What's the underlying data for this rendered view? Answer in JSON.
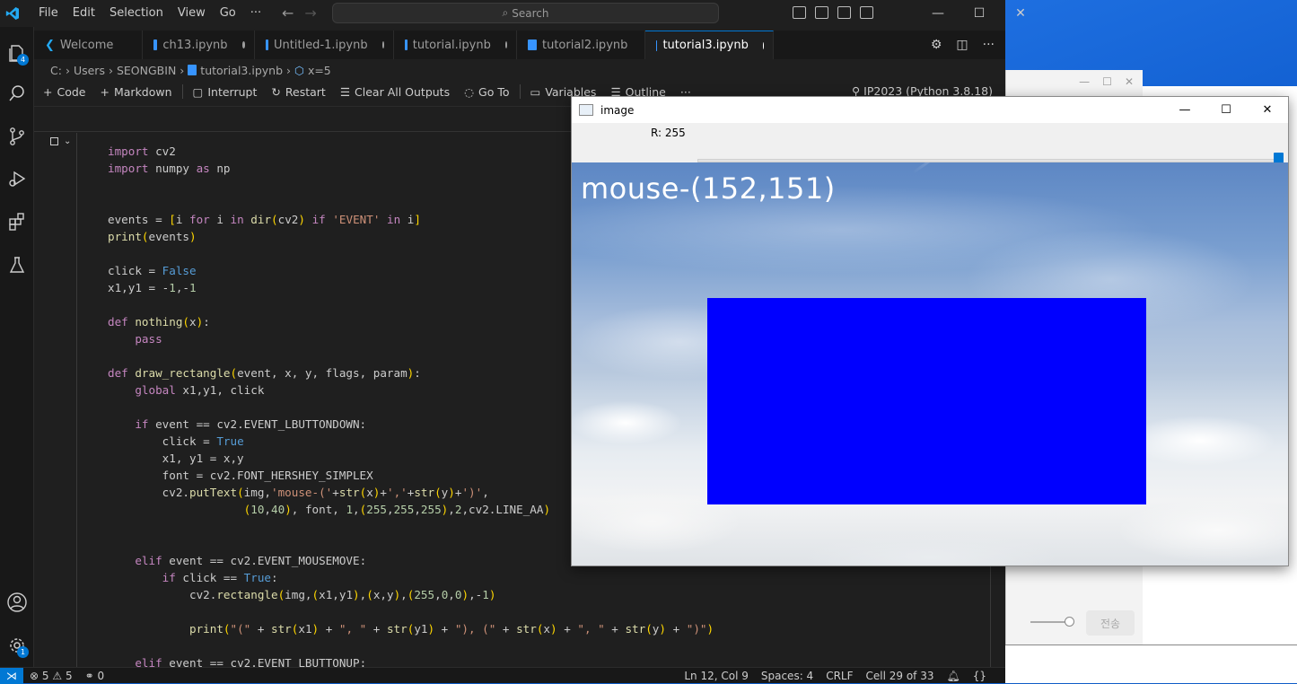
{
  "menu": [
    "File",
    "Edit",
    "Selection",
    "View",
    "Go",
    "···"
  ],
  "search": {
    "placeholder": "Search"
  },
  "tabs": [
    {
      "label": "Welcome",
      "type": "welcome"
    },
    {
      "label": "ch13.ipynb",
      "type": "notebook",
      "dirty": true
    },
    {
      "label": "Untitled-1.ipynb",
      "type": "notebook",
      "dirty": true
    },
    {
      "label": "tutorial.ipynb",
      "type": "notebook",
      "dirty": true
    },
    {
      "label": "tutorial2.ipynb",
      "type": "notebook",
      "dirty": false
    },
    {
      "label": "tutorial3.ipynb",
      "type": "notebook",
      "dirty": true,
      "active": true
    }
  ],
  "breadcrumb": [
    "C:",
    "Users",
    "SEONGBIN",
    "tutorial3.ipynb",
    "x=5"
  ],
  "toolbar": {
    "code": "Code",
    "markdown": "Markdown",
    "interrupt": "Interrupt",
    "restart": "Restart",
    "clear": "Clear All Outputs",
    "goto": "Go To",
    "variables": "Variables",
    "outline": "Outline",
    "more": "···",
    "kernel": "IP2023 (Python 3.8.18)"
  },
  "activity_badges": {
    "explorer": "4",
    "settings": "1"
  },
  "code_lines": [
    "import cv2",
    "import numpy as np",
    "",
    "",
    "events = [i for i in dir(cv2) if 'EVENT' in i]",
    "print(events)",
    "",
    "click = False",
    "x1,y1 = -1,-1",
    "",
    "def nothing(x):",
    "    pass",
    "",
    "def draw_rectangle(event, x, y, flags, param):",
    "    global x1,y1, click",
    "",
    "    if event == cv2.EVENT_LBUTTONDOWN:",
    "        click = True",
    "        x1, y1 = x,y",
    "        font = cv2.FONT_HERSHEY_SIMPLEX",
    "        cv2.putText(img,'mouse-('+str(x)+','+str(y)+')',",
    "                    (10,40), font, 1,(255,255,255),2,cv2.LINE_AA)",
    "",
    "",
    "    elif event == cv2.EVENT_MOUSEMOVE:",
    "        if click == True:",
    "            cv2.rectangle(img,(x1,y1),(x,y),(255,0,0),-1)",
    "",
    "            print(\"(\" + str(x1) + \", \" + str(y1) + \"), (\" + str(x) + \", \" + str(y) + \")\")",
    "",
    "    elif event == cv2.EVENT_LBUTTONUP:"
  ],
  "status": {
    "errors": "5",
    "warnings": "5",
    "ports": "0",
    "position": "Ln 12, Col 9",
    "spaces": "Spaces: 4",
    "eol": "CRLF",
    "cell": "Cell 29 of 33"
  },
  "image_window": {
    "title": "image",
    "trackbar_label": "R: 255",
    "trackbar_value": 255,
    "trackbar_max": 255,
    "overlay_text": "mouse-(152,151)",
    "rect_color": "#0000ff"
  },
  "background_app": {
    "send_label": "전송"
  }
}
